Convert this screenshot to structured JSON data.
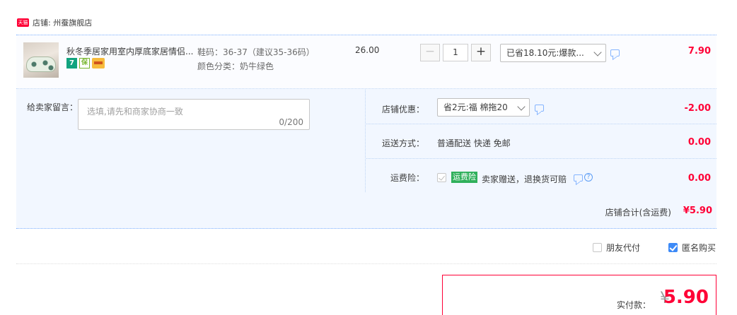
{
  "shop": {
    "badge": "天猫",
    "label": "店铺: 州蚕旗舰店"
  },
  "item": {
    "title": "秋冬季居家用室内厚底家居情侣...",
    "badges": {
      "seven": "7",
      "guarantee": "保"
    },
    "sku_size": "鞋码：36-37（建议35-36码）",
    "sku_color": "颜色分类：奶牛绿色",
    "unit_price": "26.00",
    "quantity": "1",
    "qty_minus": "−",
    "qty_plus": "+",
    "promo_selected": "已省18.10元:爆款...",
    "subtotal": "7.90"
  },
  "note": {
    "label": "给卖家留言：",
    "placeholder": "选填,请先和商家协商一致",
    "count": "0/200"
  },
  "shop_discount": {
    "label": "店铺优惠：",
    "selected": "省2元:福 棉拖20",
    "amount": "-2.00"
  },
  "shipping": {
    "label": "运送方式：",
    "value": "普通配送 快递 免邮",
    "amount": "0.00"
  },
  "insurance": {
    "label": "运费险：",
    "tag": "运费险",
    "desc": "卖家赠送，退换货可赔",
    "help": "?",
    "amount": "0.00"
  },
  "store_total": {
    "label": "店铺合计(含运费)",
    "amount": "¥5.90"
  },
  "options": {
    "friend_pay": "朋友代付",
    "anonymous": "匿名购买"
  },
  "payment": {
    "label": "实付款：",
    "currency": "¥",
    "amount": "5.90"
  },
  "colors": {
    "accent": "#ff0036",
    "panel": "#f2f7ff",
    "border": "#80b2ff",
    "check": "#3d8af7"
  },
  "icons": [
    "tmall-badge",
    "product-thumbnail",
    "chat-icon",
    "help-icon",
    "chevron-down-icon",
    "checkbox"
  ]
}
